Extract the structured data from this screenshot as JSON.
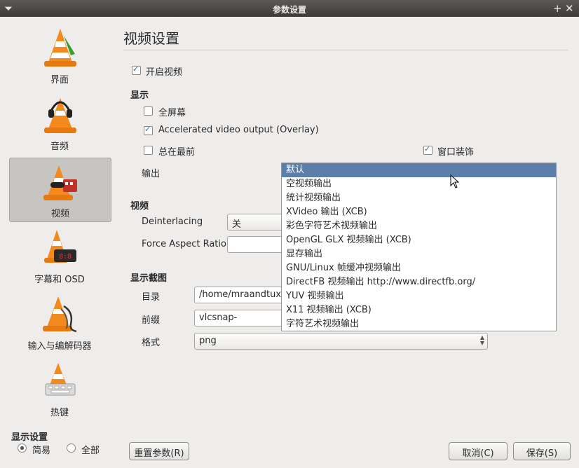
{
  "window": {
    "title": "参数设置"
  },
  "sidebar": {
    "items": [
      {
        "label": "界面"
      },
      {
        "label": "音频"
      },
      {
        "label": "视频"
      },
      {
        "label": "字幕和 OSD"
      },
      {
        "label": "输入与编解码器"
      },
      {
        "label": "热键"
      }
    ],
    "show_settings_label": "显示设置",
    "mode_simple": "简易",
    "mode_all": "全部"
  },
  "page": {
    "title": "视频设置"
  },
  "enable_video_label": "开启视频",
  "display": {
    "heading": "显示",
    "fullscreen": "全屏幕",
    "accel": "Accelerated video output (Overlay)",
    "ontop": "总在最前",
    "decorations": "窗口装饰",
    "output_label": "输出"
  },
  "video": {
    "heading": "视频",
    "deinterlacing_label": "Deinterlacing",
    "deinterlacing_value": "关",
    "aspect_label": "Force Aspect Ratio"
  },
  "snapshot": {
    "heading": "显示截图",
    "dir_label": "目录",
    "dir_value": "/home/mraandtux",
    "prefix_label": "前缀",
    "prefix_value": "vlcsnap-",
    "format_label": "格式",
    "format_value": "png"
  },
  "output_options": [
    "默认",
    "空视频输出",
    "统计视频输出",
    "XVideo 输出 (XCB)",
    "彩色字符艺术视频输出",
    "OpenGL GLX 视频输出 (XCB)",
    "显存输出",
    "GNU/Linux 帧缓冲视频输出",
    "DirectFB 视频输出 http://www.directfb.org/",
    "YUV 视频输出",
    "X11 视频输出 (XCB)",
    "字符艺术视频输出"
  ],
  "buttons": {
    "reset": "重置参数(R)",
    "cancel": "取消(C)",
    "save": "保存(S)"
  },
  "colors": {
    "selection": "#5b7fa8",
    "titlebar": "#3d3b38",
    "cone_orange": "#f28a1d"
  }
}
